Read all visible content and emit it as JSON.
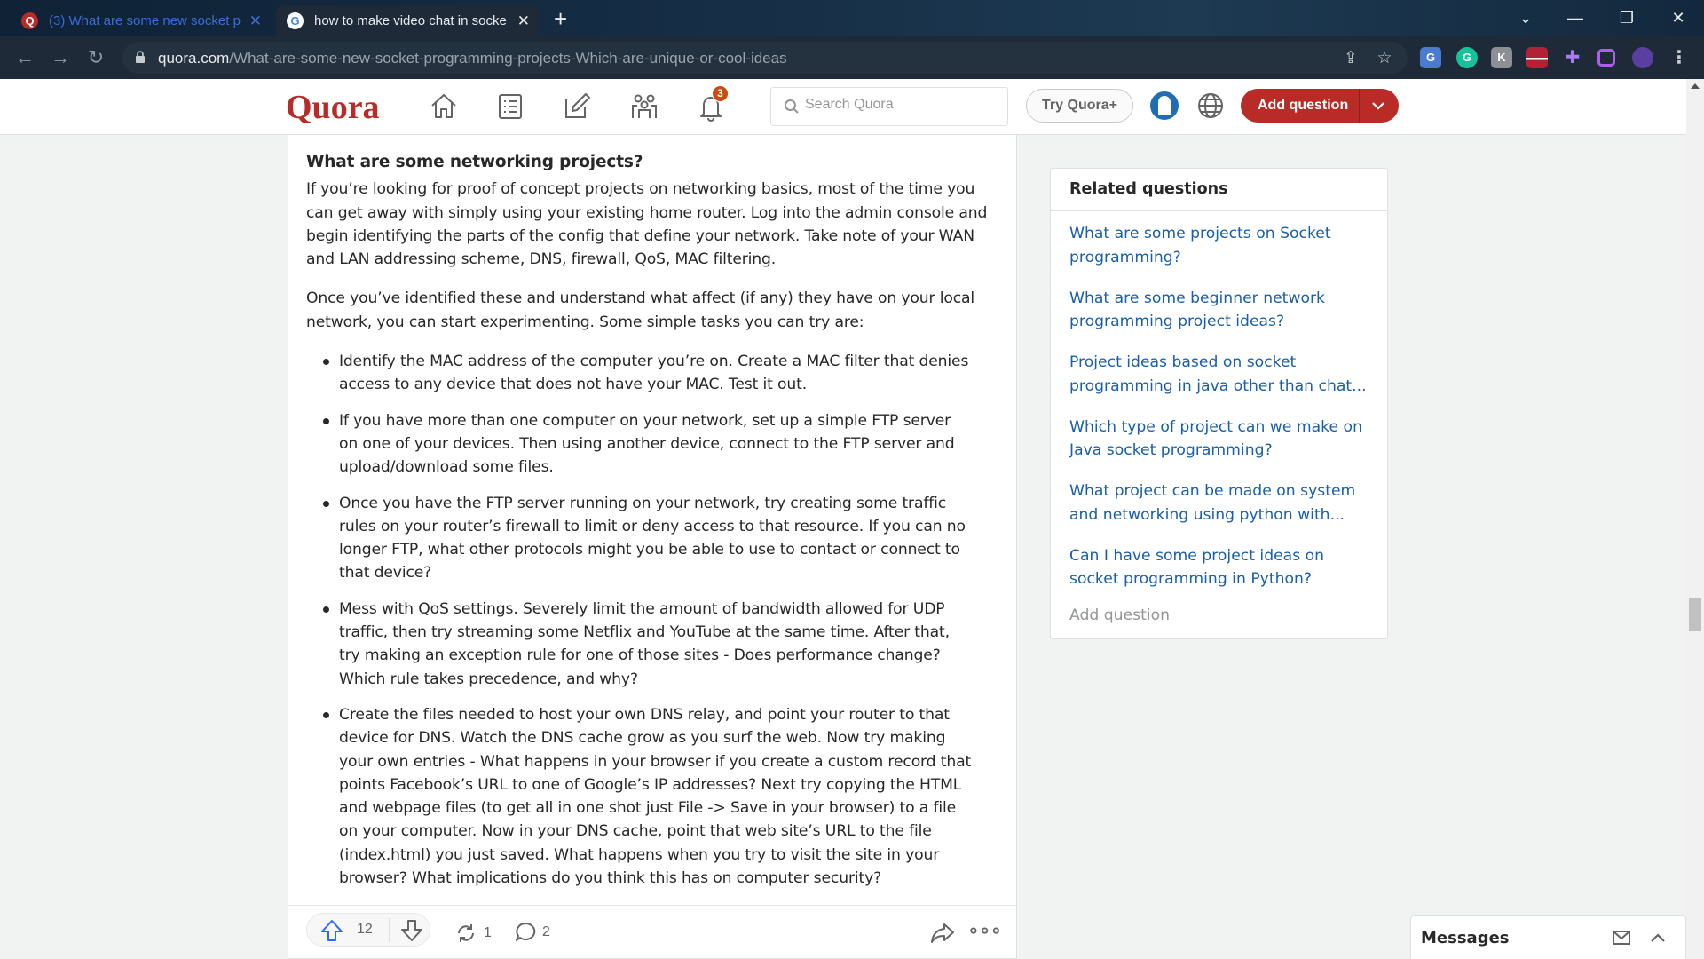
{
  "browser": {
    "tabs": [
      {
        "title": "(3) What are some new socket p",
        "active": false
      },
      {
        "title": "how to make video chat in socke",
        "active": true
      }
    ],
    "new_tab": "+",
    "url_host": "quora.com",
    "url_path": "/What-are-some-new-socket-programming-projects-Which-are-unique-or-cool-ideas"
  },
  "header": {
    "logo": "Quora",
    "notification_count": "3",
    "search_placeholder": "Search Quora",
    "try_plus": "Try Quora+",
    "add_question": "Add question"
  },
  "answer": {
    "heading": "What are some networking projects?",
    "paragraphs": [
      "If you’re looking for proof of concept projects on networking basics, most of the time you can get away with simply using your existing home router. Log into the admin console and begin identifying the parts of the config that define your network. Take note of your WAN and LAN addressing scheme, DNS, firewall, QoS, MAC filtering.",
      "Once you’ve identified these and understand what affect (if any) they have on your local network, you can start experimenting. Some simple tasks you can try are:"
    ],
    "bullets": [
      "Identify the MAC address of the computer you’re on. Create a MAC filter that denies access to any device that does not have your MAC. Test it out.",
      "If you have more than one computer on your network, set up a simple FTP server on one of your devices. Then using another device, connect to the FTP server and upload/download some files.",
      "Once you have the FTP server running on your network, try creating some traffic rules on your router’s firewall to limit or deny access to that resource. If you can no longer FTP, what other protocols might you be able to use to contact or connect to that device?",
      "Mess with QoS settings. Severely limit the amount of bandwidth allowed for UDP traffic, then try streaming some Netflix and YouTube at the same time. After that, try making an exception rule for one of those sites - Does performance change? Which rule takes precedence, and why?",
      "Create the files needed to host your own DNS relay, and point your router to that device for DNS. Watch the DNS cache grow as you surf the web. Now try making your own entries - What happens in your browser if you create a custom record that points Facebook’s URL to one of Google’s IP addresses? Next try copying the HTML and webpage files (to get all in one shot just File -> Save in your browser) to a file on your computer. Now in your DNS cache, point that web site’s URL to the file (index.html) you just saved. What happens when you try to visit the site in your browser? What implications do you think this has on computer security?"
    ],
    "actions": {
      "upvotes": "12",
      "shares": "1",
      "comments": "2"
    }
  },
  "related": {
    "title": "Related questions",
    "questions": [
      "What are some projects on Socket programming?",
      "What are some beginner network programming project ideas?",
      "Project ideas based on socket programming in java other than chat...",
      "Which type of project can we make on Java socket programming?",
      "What project can be made on system and networking using python with...",
      "Can I have some project ideas on socket programming in Python?"
    ],
    "add_question": "Add question"
  },
  "messages": {
    "label": "Messages"
  },
  "colors": {
    "brand": "#b92b27",
    "link": "#195faa",
    "text": "#282829"
  }
}
